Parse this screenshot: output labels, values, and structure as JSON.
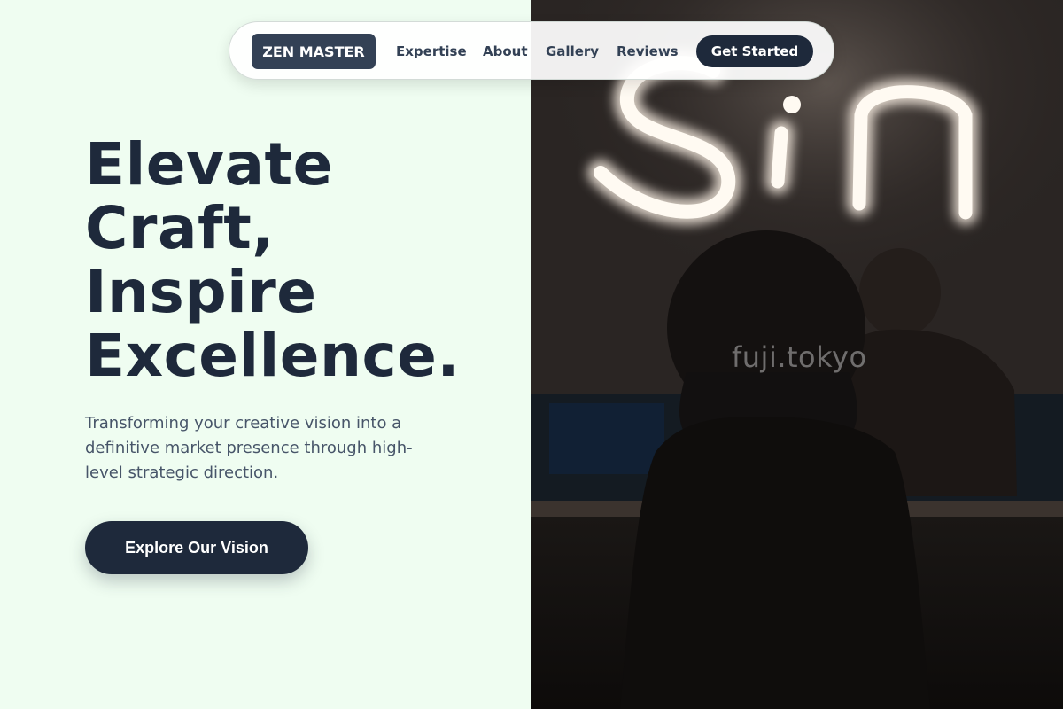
{
  "nav": {
    "brand": "ZEN MASTER",
    "links": [
      "Expertise",
      "About",
      "Gallery",
      "Reviews"
    ],
    "cta": "Get Started"
  },
  "hero": {
    "headline": [
      "Elevate",
      "Craft,",
      "Inspire",
      "Excellence."
    ],
    "subtext": "Transforming your creative vision into a definitive market presence through high-level strategic direction.",
    "cta": "Explore Our Vision"
  },
  "photo": {
    "watermark": "fuji.tokyo",
    "neon_text": "Sin"
  },
  "colors": {
    "background": "#effdf1",
    "primary": "#1e293b",
    "brand_bg": "#334155",
    "body_text": "#475569"
  }
}
